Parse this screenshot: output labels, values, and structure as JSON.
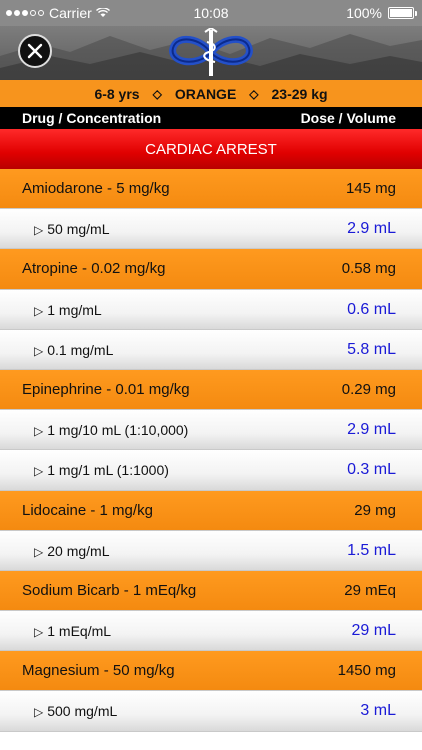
{
  "status_bar": {
    "carrier": "Carrier",
    "time": "10:08",
    "battery": "100%"
  },
  "info": {
    "age": "6-8 yrs",
    "color": "ORANGE",
    "weight": "23-29 kg",
    "separator": "◇"
  },
  "columns": {
    "drug": "Drug / Concentration",
    "dose": "Dose / Volume"
  },
  "section": {
    "title": "CARDIAC ARREST"
  },
  "rows": [
    {
      "type": "drug",
      "name": "Amiodarone - 5 mg/kg",
      "value": "145 mg"
    },
    {
      "type": "conc",
      "name": "50 mg/mL",
      "value": "2.9 mL"
    },
    {
      "type": "drug",
      "name": "Atropine - 0.02 mg/kg",
      "value": "0.58 mg"
    },
    {
      "type": "conc",
      "name": "1 mg/mL",
      "value": "0.6 mL"
    },
    {
      "type": "conc",
      "name": "0.1 mg/mL",
      "value": "5.8 mL"
    },
    {
      "type": "drug",
      "name": "Epinephrine - 0.01 mg/kg",
      "value": "0.29 mg"
    },
    {
      "type": "conc",
      "name": "1 mg/10 mL (1:10,000)",
      "value": "2.9 mL"
    },
    {
      "type": "conc",
      "name": "1 mg/1 mL (1:1000)",
      "value": "0.3 mL"
    },
    {
      "type": "drug",
      "name": "Lidocaine - 1 mg/kg",
      "value": "29 mg"
    },
    {
      "type": "conc",
      "name": "20 mg/mL",
      "value": "1.5 mL"
    },
    {
      "type": "drug",
      "name": "Sodium Bicarb - 1 mEq/kg",
      "value": "29 mEq"
    },
    {
      "type": "conc",
      "name": "1 mEq/mL",
      "value": "29 mL"
    },
    {
      "type": "drug",
      "name": "Magnesium - 50 mg/kg",
      "value": "1450 mg"
    },
    {
      "type": "conc",
      "name": "500 mg/mL",
      "value": "3 mL"
    }
  ],
  "colors": {
    "orange": "#f7941d",
    "red": "#e00000",
    "volume_blue": "#1a1ad6"
  },
  "icons": {
    "close": "close-icon",
    "logo": "star-of-life-logo",
    "triangle": "▷"
  }
}
